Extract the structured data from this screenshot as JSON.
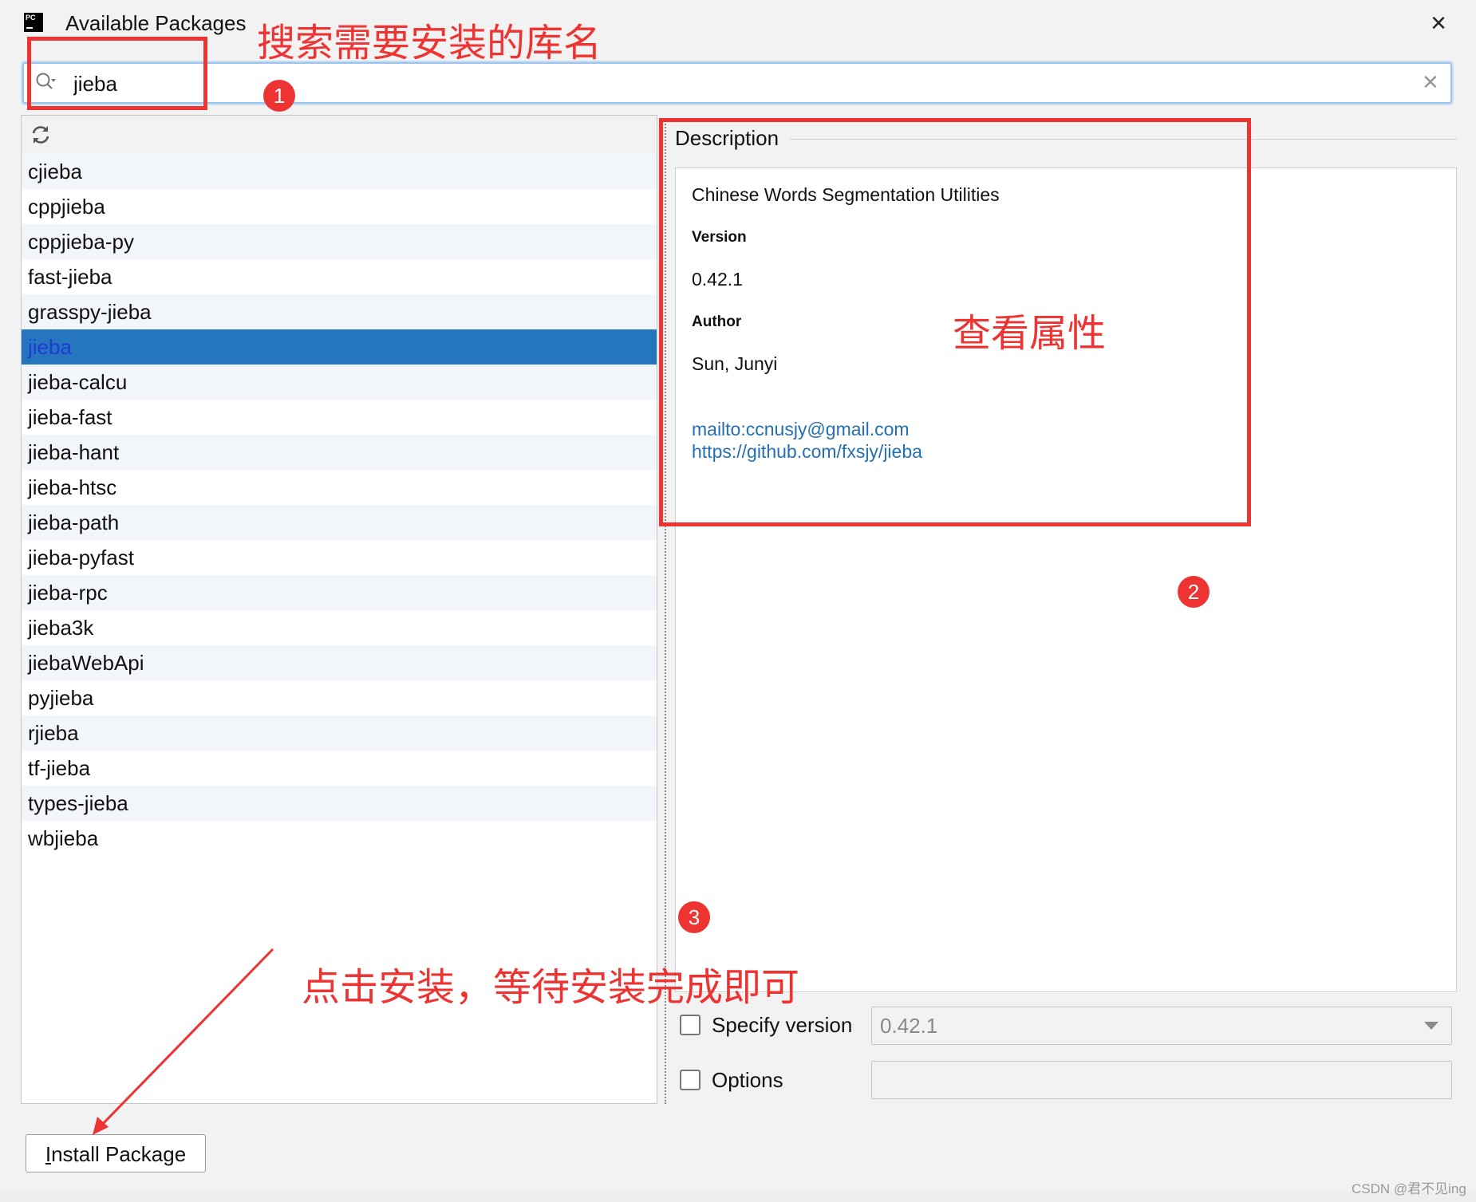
{
  "window": {
    "title": "Available Packages",
    "app_icon_text": "PC"
  },
  "search": {
    "value": "jieba"
  },
  "packages": [
    "cjieba",
    "cppjieba",
    "cppjieba-py",
    "fast-jieba",
    "grasspy-jieba",
    "jieba",
    "jieba-calcu",
    "jieba-fast",
    "jieba-hant",
    "jieba-htsc",
    "jieba-path",
    "jieba-pyfast",
    "jieba-rpc",
    "jieba3k",
    "jiebaWebApi",
    "pyjieba",
    "rjieba",
    "tf-jieba",
    "types-jieba",
    "wbjieba"
  ],
  "selected_package": "jieba",
  "description": {
    "header": "Description",
    "summary": "Chinese Words Segmentation Utilities",
    "version_label": "Version",
    "version": "0.42.1",
    "author_label": "Author",
    "author": "Sun, Junyi",
    "email_link": "mailto:ccnusjy@gmail.com",
    "homepage_link": "https://github.com/fxsjy/jieba"
  },
  "options": {
    "specify_version_label": "Specify version",
    "specify_version_checked": false,
    "version_value": "0.42.1",
    "options_label": "Options",
    "options_checked": false,
    "options_value": ""
  },
  "install_button": {
    "mnemonic": "I",
    "rest": "nstall Package"
  },
  "annotations": {
    "text_1": "搜索需要安装的库名",
    "text_2": "查看属性",
    "text_3": "点击安装，等待安装完成即可",
    "badge_1": "1",
    "badge_2": "2",
    "badge_3": "3"
  },
  "watermark": "CSDN @君不见ing",
  "colors": {
    "selection": "#2675bf",
    "link": "#2470b3",
    "annotation": "#ee3333",
    "search_focus": "#9cc3ea"
  }
}
